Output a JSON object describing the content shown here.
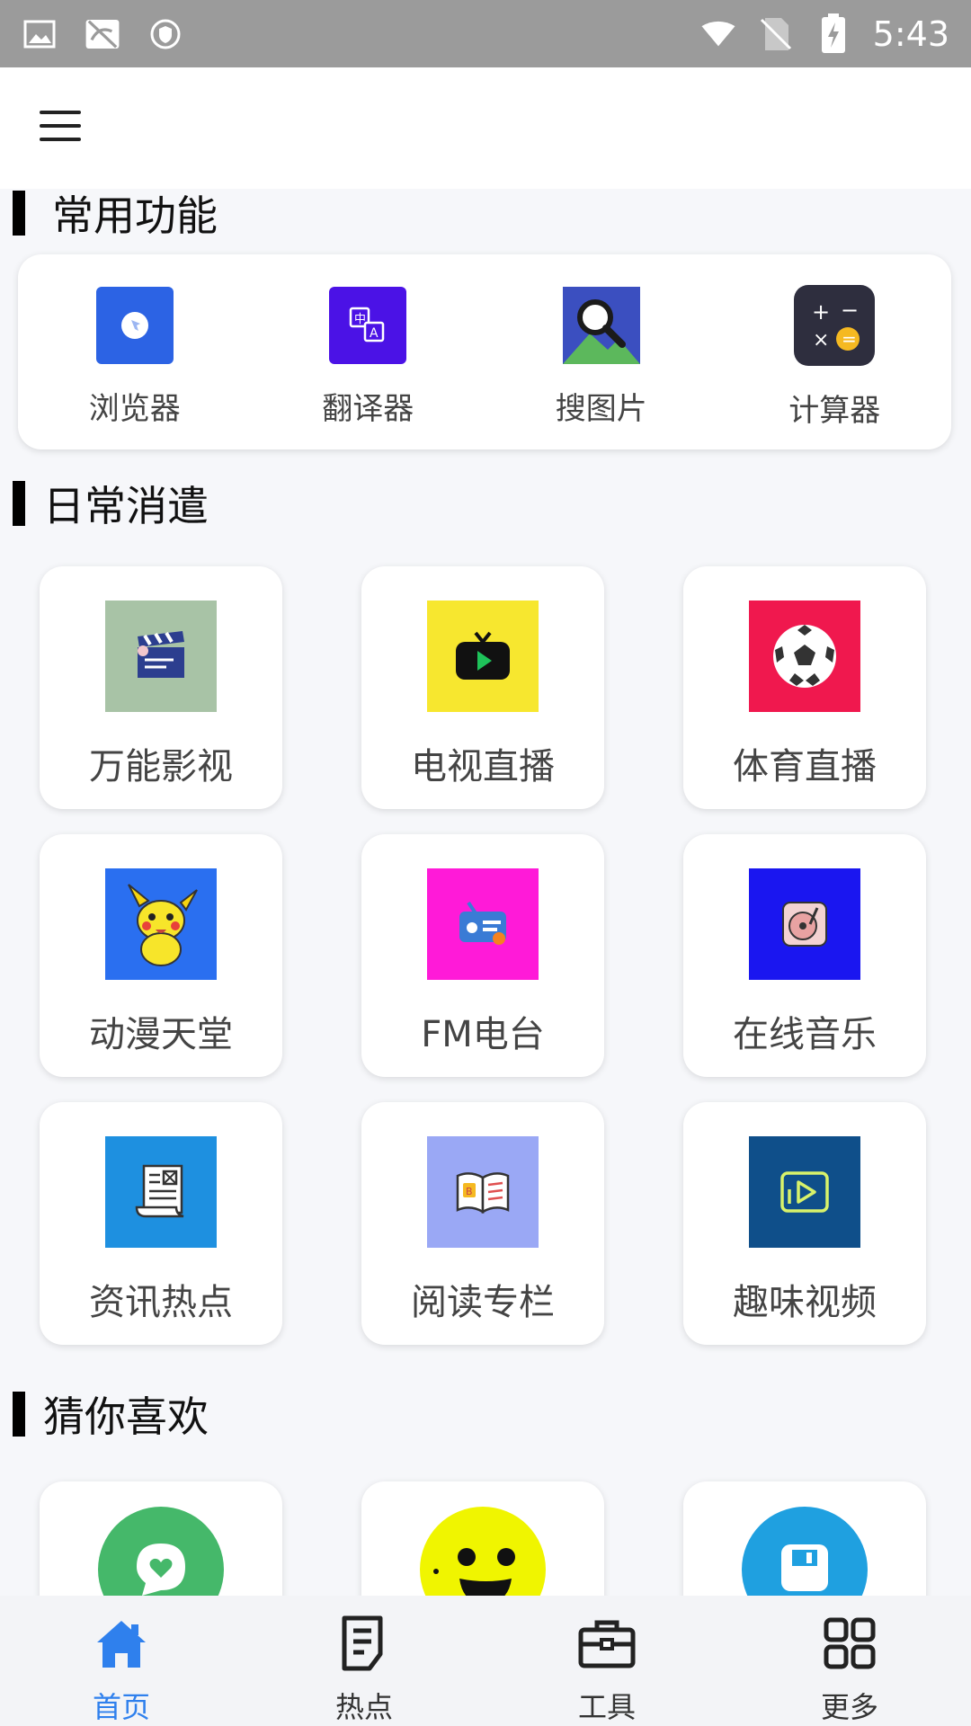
{
  "status_bar": {
    "time": "5:43",
    "icons": [
      "image-icon",
      "no-signal-app-icon",
      "shield-icon",
      "wifi-icon",
      "no-sim-icon",
      "battery-charging-icon"
    ]
  },
  "app_bar": {
    "menu_icon": "hamburger-menu-icon"
  },
  "sections": {
    "common": {
      "title": "常用功能",
      "items": [
        {
          "label": "浏览器",
          "icon": "browser-icon",
          "color": "#2c63e4"
        },
        {
          "label": "翻译器",
          "icon": "translate-icon",
          "color": "#4b12e6"
        },
        {
          "label": "搜图片",
          "icon": "image-search-icon",
          "color": "#3b4fc0"
        },
        {
          "label": "计算器",
          "icon": "calculator-icon",
          "color": "#2e2e3e"
        }
      ]
    },
    "daily": {
      "title": "日常消遣",
      "items": [
        {
          "label": "万能影视",
          "icon": "clapperboard-icon",
          "color": "#a8c3a6"
        },
        {
          "label": "电视直播",
          "icon": "tv-icon",
          "color": "#f7e72f"
        },
        {
          "label": "体育直播",
          "icon": "soccer-ball-icon",
          "color": "#f0184e"
        },
        {
          "label": "动漫天堂",
          "icon": "pikachu-icon",
          "color": "#2a6ff0"
        },
        {
          "label": "FM电台",
          "icon": "radio-icon",
          "color": "#ff1ad8"
        },
        {
          "label": "在线音乐",
          "icon": "turntable-icon",
          "color": "#1a16f0"
        },
        {
          "label": "资讯热点",
          "icon": "newspaper-icon",
          "color": "#1e90e0"
        },
        {
          "label": "阅读专栏",
          "icon": "open-book-icon",
          "color": "#9aa8f5"
        },
        {
          "label": "趣味视频",
          "icon": "video-play-icon",
          "color": "#0f4f8a"
        }
      ]
    },
    "guess": {
      "title": "猜你喜欢",
      "items": [
        {
          "icon": "chat-heart-icon",
          "color": "#45b86a"
        },
        {
          "icon": "smiley-face-icon",
          "color": "#f0f500"
        },
        {
          "icon": "save-disk-icon",
          "color": "#1fa0e0"
        }
      ]
    }
  },
  "bottom_nav": [
    {
      "label": "首页",
      "icon": "home-icon",
      "active": true
    },
    {
      "label": "热点",
      "icon": "document-icon",
      "active": false
    },
    {
      "label": "工具",
      "icon": "toolbox-icon",
      "active": false
    },
    {
      "label": "更多",
      "icon": "grid-icon",
      "active": false
    }
  ],
  "colors": {
    "accent": "#2f80ed",
    "background": "#f6f7fa"
  }
}
